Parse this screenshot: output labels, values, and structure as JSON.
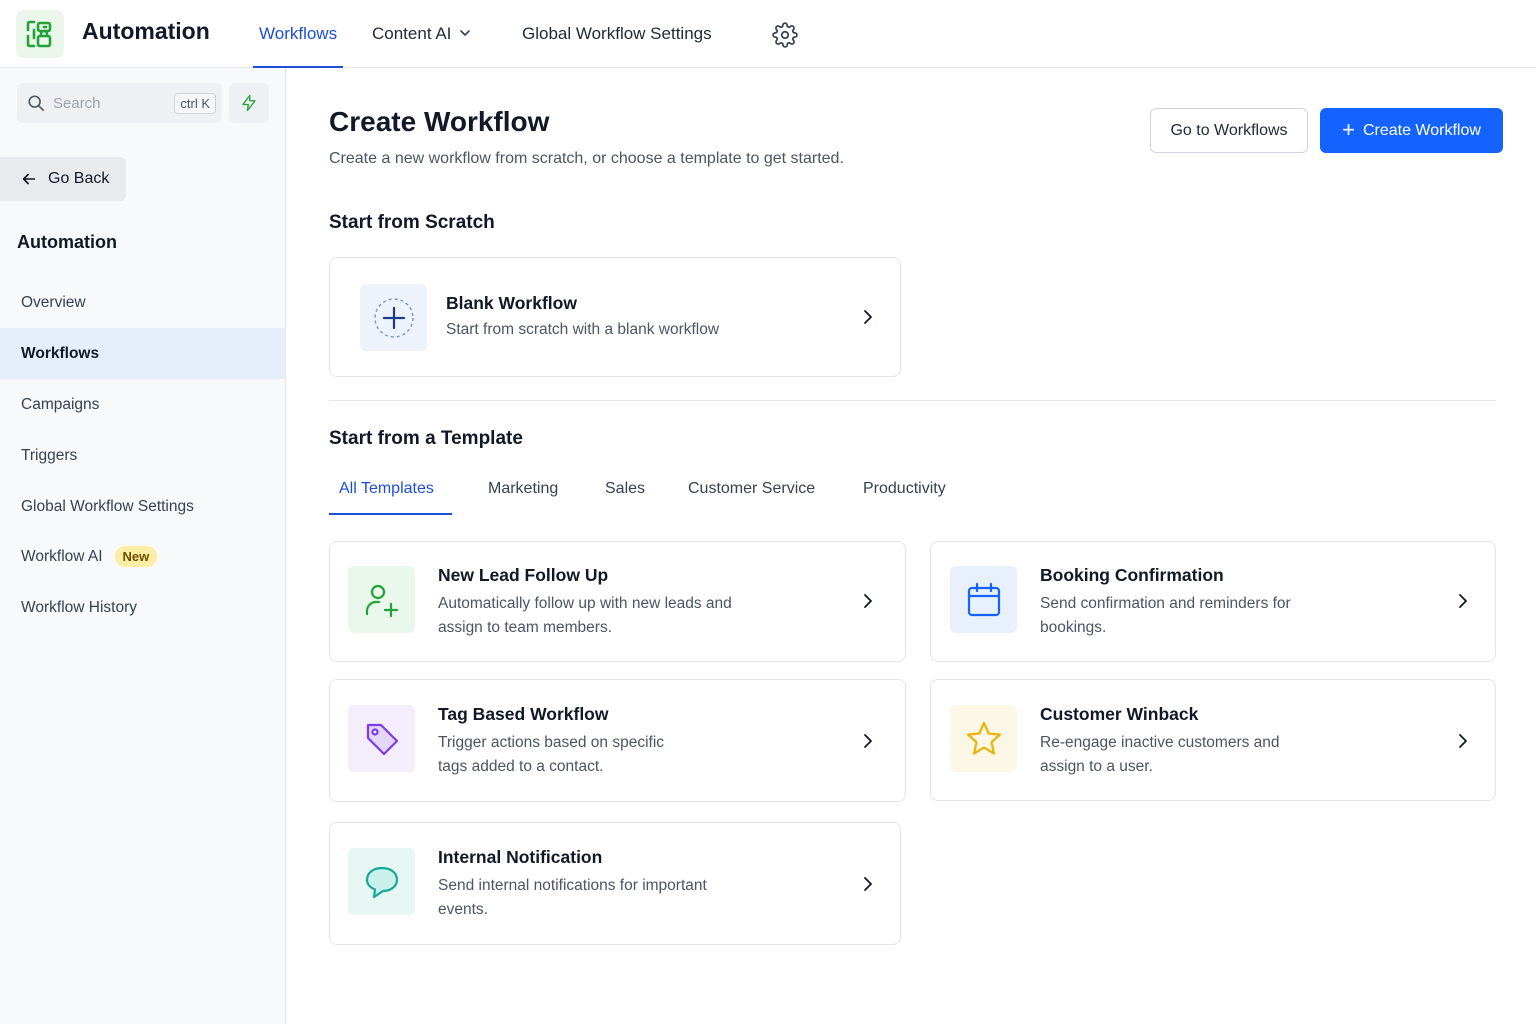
{
  "app": {
    "title": "Automation"
  },
  "topnav": {
    "tabs": [
      {
        "label": "Workflows",
        "active": true
      },
      {
        "label": "Content AI",
        "active": false,
        "has_dropdown": true
      },
      {
        "label": "Global Workflow Settings",
        "active": false
      }
    ],
    "settings_icon": "gear-icon"
  },
  "sidebar": {
    "search_placeholder": "Search",
    "search_shortcut": "ctrl K",
    "go_back_label": "Go Back",
    "section_title": "Automation",
    "items": [
      {
        "label": "Overview",
        "active": false
      },
      {
        "label": "Workflows",
        "active": true
      },
      {
        "label": "Campaigns",
        "active": false
      },
      {
        "label": "Triggers",
        "active": false
      },
      {
        "label": "Global Workflow Settings",
        "active": false
      },
      {
        "label": "Workflow AI",
        "active": false,
        "badge": "New"
      },
      {
        "label": "Workflow History",
        "active": false
      }
    ]
  },
  "main": {
    "title": "Create Workflow",
    "subtitle": "Create a new workflow from scratch, or choose a template to get started.",
    "go_to_workflows_label": "Go to Workflows",
    "create_workflow_label": "Create Workflow",
    "scratch_section_title": "Start from Scratch",
    "blank": {
      "title": "Blank Workflow",
      "description": "Start from scratch with a blank workflow",
      "icon": "plus-circle-icon"
    },
    "template_section_title": "Start from a Template",
    "template_tabs": [
      {
        "label": "All Templates",
        "active": true
      },
      {
        "label": "Marketing",
        "active": false
      },
      {
        "label": "Sales",
        "active": false
      },
      {
        "label": "Customer Service",
        "active": false
      },
      {
        "label": "Productivity",
        "active": false
      }
    ],
    "templates": [
      {
        "title": "New Lead Follow Up",
        "line1": "Automatically follow up with new leads and",
        "line2": "assign to team members.",
        "icon": "user-plus-icon"
      },
      {
        "title": "Booking Confirmation",
        "line1": "Send confirmation and reminders for",
        "line2": "bookings.",
        "icon": "calendar-icon"
      },
      {
        "title": "Tag Based Workflow",
        "line1": "Trigger actions based on specific",
        "line2": "tags added to a contact.",
        "icon": "tag-icon"
      },
      {
        "title": "Customer Winback",
        "line1": "Re-engage inactive customers and",
        "line2": "assign to a user.",
        "icon": "star-icon"
      },
      {
        "title": "Internal Notification",
        "line1": "Send internal notifications for important",
        "line2": "events.",
        "icon": "chat-bubble-icon"
      }
    ]
  },
  "colors": {
    "primary": "#1463ff",
    "active_tab": "#1d4ed8",
    "sidebar_bg": "#f8f9fb",
    "sidebar_active_bg": "#e6eefb",
    "badge_bg": "#fdeea6",
    "logo_green": "#22a33a"
  }
}
